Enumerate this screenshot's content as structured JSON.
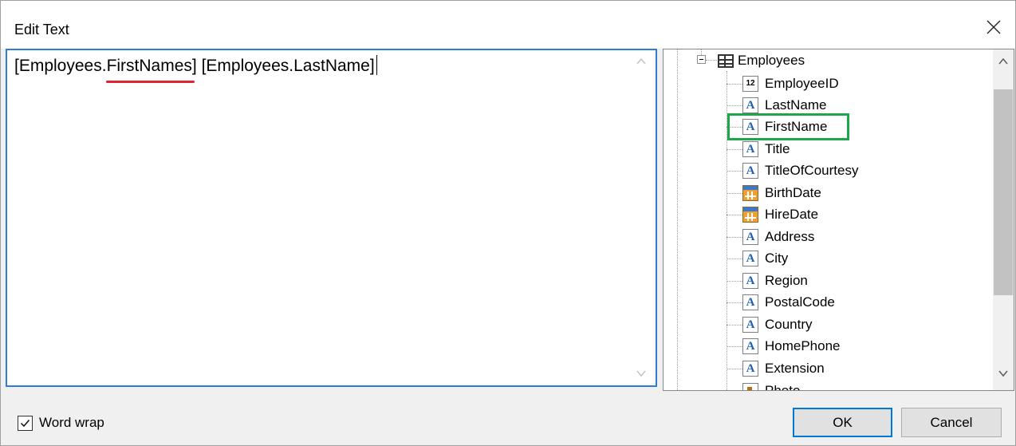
{
  "dialog": {
    "title": "Edit Text",
    "close_icon": "close-icon"
  },
  "editor": {
    "text_before": "[Employees.",
    "text_error": "FirstNames",
    "text_after": "] [Employees.LastName]",
    "error_underline_color": "#e0232e",
    "focus_border_color": "#2f7dd1"
  },
  "tree": {
    "root": {
      "label": "Employees",
      "icon": "table-icon",
      "expanded": true
    },
    "fields": [
      {
        "label": "EmployeeID",
        "icon": "number-field-icon"
      },
      {
        "label": "LastName",
        "icon": "text-field-icon"
      },
      {
        "label": "FirstName",
        "icon": "text-field-icon",
        "highlighted": true
      },
      {
        "label": "Title",
        "icon": "text-field-icon"
      },
      {
        "label": "TitleOfCourtesy",
        "icon": "text-field-icon"
      },
      {
        "label": "BirthDate",
        "icon": "date-field-icon"
      },
      {
        "label": "HireDate",
        "icon": "date-field-icon"
      },
      {
        "label": "Address",
        "icon": "text-field-icon"
      },
      {
        "label": "City",
        "icon": "text-field-icon"
      },
      {
        "label": "Region",
        "icon": "text-field-icon"
      },
      {
        "label": "PostalCode",
        "icon": "text-field-icon"
      },
      {
        "label": "Country",
        "icon": "text-field-icon"
      },
      {
        "label": "HomePhone",
        "icon": "text-field-icon"
      },
      {
        "label": "Extension",
        "icon": "text-field-icon"
      },
      {
        "label": "Photo",
        "icon": "photo-field-icon"
      }
    ],
    "highlight_color": "#1ea64a"
  },
  "footer": {
    "word_wrap_label": "Word wrap",
    "word_wrap_checked": true,
    "ok_label": "OK",
    "cancel_label": "Cancel",
    "default_button_border_color": "#0078d7"
  }
}
